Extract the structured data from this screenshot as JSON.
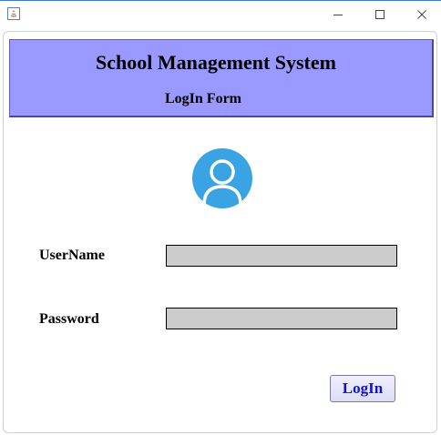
{
  "window": {
    "title": ""
  },
  "header": {
    "title": "School Management System",
    "subtitle": "LogIn Form",
    "background": "#9999ff"
  },
  "avatar": {
    "icon": "user-avatar-icon",
    "color": "#3aa3e3"
  },
  "form": {
    "username_label": "UserName",
    "username_value": "",
    "password_label": "Password",
    "password_value": "",
    "field_background": "#cccccc"
  },
  "login_button": {
    "label": "LogIn",
    "text_color": "#1414c8"
  }
}
